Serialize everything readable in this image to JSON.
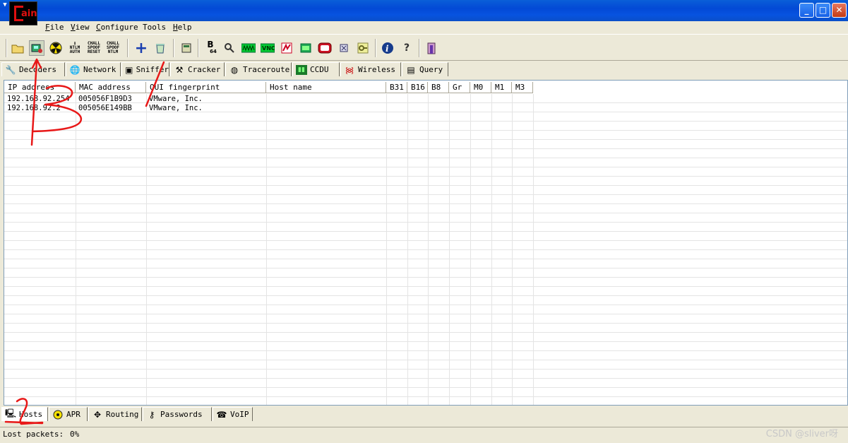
{
  "window": {
    "sysmenu_glyph": "▼",
    "logo_c": "C",
    "logo_text": "ain",
    "min_glyph": "_",
    "max_glyph": "□",
    "close_glyph": "✕"
  },
  "menu": [
    {
      "accel": "F",
      "rest": "ile"
    },
    {
      "accel": "V",
      "rest": "iew"
    },
    {
      "accel": "C",
      "rest": "onfigure"
    },
    {
      "accel": "",
      "rest": "Tools"
    },
    {
      "accel": "H",
      "rest": "elp"
    }
  ],
  "toolbar": {
    "icons": [
      "open-folder-icon",
      "sniffer-start-icon",
      "apr-poison-icon",
      "ntlm-auth-icon",
      "chall-spoof-reset-icon",
      "chall-spoof-ntlm-icon",
      "add-icon",
      "recycle-icon",
      "hash-calculator-icon",
      "base64-icon",
      "lsa-secrets-icon",
      "pwl-icon",
      "vnc-icon",
      "rdp-icon",
      "terminal-icon",
      "cisco-icon",
      "wireless-icon",
      "password-icon",
      "info-icon",
      "help-icon",
      "exit-icon"
    ],
    "ntlm_line1": "NTLM",
    "ntlm_line2": "AUTH",
    "chall1_l1": "CHALL",
    "chall1_l2": "SPOOF",
    "chall1_l3": "RESET",
    "chall2_l1": "CHALL",
    "chall2_l2": "SPOOF",
    "chall2_l3": "NTLM",
    "b64_big": "B",
    "b64_small": "64",
    "vnc_text": "VNC"
  },
  "top_tabs": [
    {
      "label": "Decoders",
      "icon": "decoders-icon"
    },
    {
      "label": "Network",
      "icon": "network-icon"
    },
    {
      "label": "Sniffer",
      "icon": "sniffer-icon"
    },
    {
      "label": "Cracker",
      "icon": "cracker-icon"
    },
    {
      "label": "Traceroute",
      "icon": "traceroute-icon"
    },
    {
      "label": "CCDU",
      "icon": "ccdu-icon"
    },
    {
      "label": "Wireless",
      "icon": "wireless-icon"
    },
    {
      "label": "Query",
      "icon": "query-icon"
    }
  ],
  "hosts_table": {
    "columns": [
      "IP address",
      "MAC address",
      "OUI fingerprint",
      "Host name",
      "B31",
      "B16",
      "B8",
      "Gr",
      "M0",
      "M1",
      "M3"
    ],
    "rows": [
      {
        "ip": "192.168.92.254",
        "mac": "005056F1B9D3",
        "oui": "VMware, Inc.",
        "host": ""
      },
      {
        "ip": "192.168.92.2",
        "mac": "005056E149BB",
        "oui": "VMware, Inc.",
        "host": ""
      }
    ]
  },
  "bottom_tabs": [
    {
      "label": "Hosts",
      "icon": "hosts-icon"
    },
    {
      "label": "APR",
      "icon": "apr-icon"
    },
    {
      "label": "Routing",
      "icon": "routing-icon"
    },
    {
      "label": "Passwords",
      "icon": "passwords-icon"
    },
    {
      "label": "VoIP",
      "icon": "voip-icon"
    }
  ],
  "status": {
    "label": "Lost packets:",
    "value": "0%"
  },
  "watermark": "CSDN @sliver呀",
  "annotation_color": "#e81818"
}
